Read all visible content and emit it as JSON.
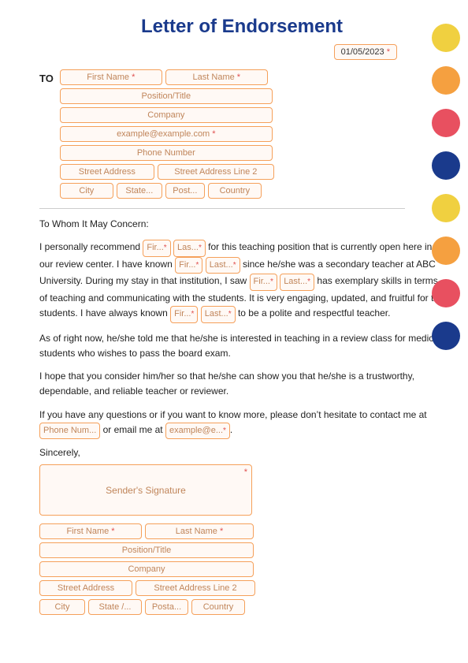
{
  "title": "Letter of Endorsement",
  "date": "01/05/2023",
  "circles": [
    {
      "color": "#f0d040"
    },
    {
      "color": "#f5a040"
    },
    {
      "color": "#e85060"
    },
    {
      "color": "#1a3a8c"
    },
    {
      "color": "#f0d040"
    },
    {
      "color": "#f5a040"
    },
    {
      "color": "#e85060"
    },
    {
      "color": "#1a3a8c"
    }
  ],
  "to_label": "TO",
  "recipient_fields": {
    "first_name": "First Name",
    "last_name": "Last Name",
    "position_title": "Position/Title",
    "company": "Company",
    "email": "example@example.com",
    "phone": "Phone Number",
    "street_address": "Street Address",
    "street_address2": "Street Address Line 2",
    "city": "City",
    "state": "State...",
    "postal": "Post...",
    "country": "Country"
  },
  "body": {
    "salutation": "To Whom It May Concern:",
    "paragraph1_pre1": "I personally recommend ",
    "inline1a": "Fir...*",
    "inline1b": "Las...*",
    "paragraph1_mid1": " for this teaching position that is currently open here in our review center. I have known ",
    "inline2a": "Fir...*",
    "inline2b": "Last...*",
    "paragraph1_mid2": " since he/she was a secondary teacher at ABC University. During my stay in that institution, I saw ",
    "inline3a": "Fir...*",
    "inline3b": "Last...*",
    "paragraph1_mid3": " has exemplary skills in terms of teaching and communicating with the students. It is very engaging, updated, and fruitful for the students. I have always known ",
    "inline4a": "Fir...*",
    "inline4b": "Last...*",
    "paragraph1_end": " to be a polite and respectful teacher.",
    "paragraph2": "As of right now, he/she told me that he/she is interested in teaching in a review class for medical students who wishes to pass the board exam.",
    "paragraph3": "I hope that you consider him/her so that he/she can show you that he/she is a trustworthy, dependable, and reliable teacher or reviewer.",
    "paragraph4_pre": "If you have any questions or if you want to know more, please don’t hesitate to contact me at ",
    "phone_inline": "Phone Num...",
    "paragraph4_mid": " or email me at ",
    "email_inline": "example@e...*",
    "paragraph4_end": "."
  },
  "sincerely": "Sincerely,",
  "sender": {
    "signature_label": "Sender's Signature",
    "first_name": "First Name",
    "last_name": "Last Name",
    "position_title": "Position/Title",
    "company": "Company",
    "street_address": "Street Address",
    "street_address2": "Street Address Line 2",
    "city": "City",
    "state": "State /...",
    "postal": "Posta...",
    "country": "Country"
  }
}
